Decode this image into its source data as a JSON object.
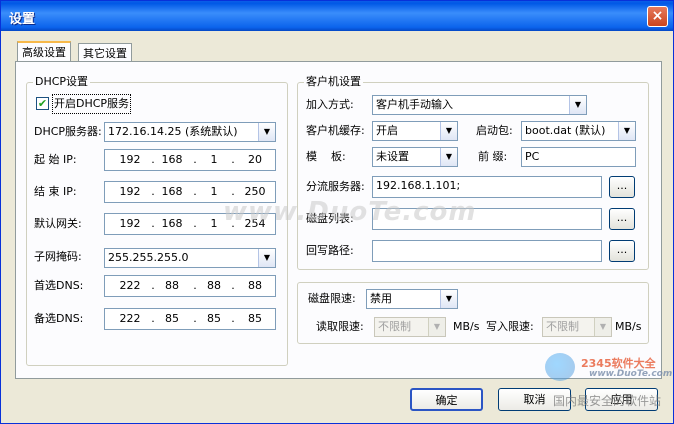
{
  "window": {
    "title": "设置",
    "close_glyph": "×"
  },
  "tabs": [
    {
      "label": "高级设置"
    },
    {
      "label": "其它设置"
    }
  ],
  "dhcp": {
    "group_title": "DHCP设置",
    "enable_label": "开启DHCP服务",
    "enable_checked": true,
    "server_label": "DHCP服务器:",
    "server_value": "172.16.14.25 (系统默认)",
    "start_ip_label": "起 始 IP:",
    "start_ip": [
      "192",
      "168",
      "1",
      "20"
    ],
    "end_ip_label": "结 束 IP:",
    "end_ip": [
      "192",
      "168",
      "1",
      "250"
    ],
    "gateway_label": "默认网关:",
    "gateway": [
      "192",
      "168",
      "1",
      "254"
    ],
    "mask_label": "子网掩码:",
    "mask_value": "255.255.255.0",
    "dns1_label": "首选DNS:",
    "dns1": [
      "222",
      "88",
      "88",
      "88"
    ],
    "dns2_label": "备选DNS:",
    "dns2": [
      "222",
      "85",
      "85",
      "85"
    ],
    "dot": "."
  },
  "client": {
    "group_title": "客户机设置",
    "join_label": "加入方式:",
    "join_value": "客户机手动输入",
    "cache_label": "客户机缓存:",
    "cache_value": "开启",
    "boot_label": "启动包:",
    "boot_value": "boot.dat (默认)",
    "template_label": "模    板:",
    "template_value": "未设置",
    "prefix_label": "前 缀:",
    "prefix_value": "PC",
    "split_label": "分流服务器:",
    "split_value": "192.168.1.101;",
    "disk_list_label": "磁盘列表:",
    "disk_list_value": "",
    "writeback_label": "回写路径:",
    "writeback_value": "",
    "browse_label": "..."
  },
  "disk_limit": {
    "label": "磁盘限速:",
    "value": "禁用",
    "read_label": "读取限速:",
    "read_value": "不限制",
    "read_unit": "MB/s",
    "write_label": "写入限速:",
    "write_value": "不限制",
    "write_unit": "MB/s"
  },
  "buttons": {
    "ok": "确定",
    "cancel": "取消",
    "apply": "应用"
  },
  "watermarks": {
    "main": "www.DuoTe.com",
    "logo": "2345软件大全",
    "logo_url": "www.DuoTe.com",
    "site": "国内最安全的软件站"
  }
}
